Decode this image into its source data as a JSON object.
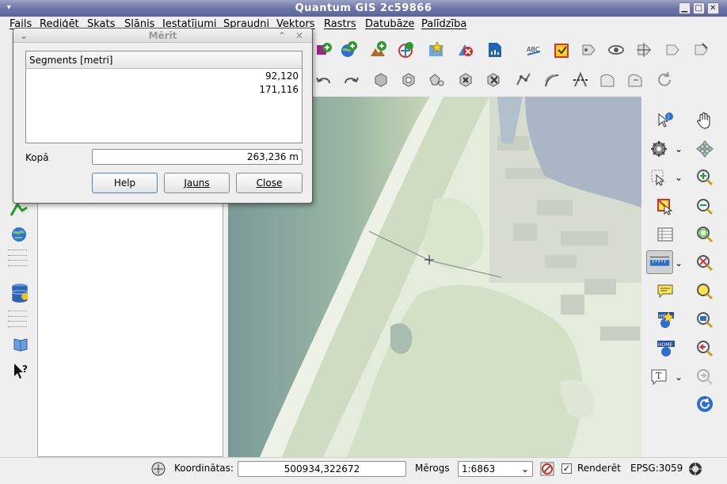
{
  "window": {
    "title": "Quantum GIS 2c59866"
  },
  "menu": [
    "Fails",
    "Rediģēt",
    "Skats",
    "Slānis",
    "Iestatījumi",
    "Spraudņi",
    "Vektors",
    "Rastrs",
    "Datubāze",
    "Palīdzība"
  ],
  "dialog": {
    "title": "Mērīt",
    "column_header": "Segments [metri]",
    "segments": [
      "92,120",
      "171,116"
    ],
    "total_label": "Kopā",
    "total_value": "263,236 m",
    "buttons": {
      "help": "Help",
      "new": "Jauns",
      "close": "Close"
    }
  },
  "status": {
    "coord_label": "Koordinātas:",
    "coord_value": "500934,322672",
    "scale_label": "Mērogs",
    "scale_value": "1:6863",
    "render_label": "Renderēt",
    "render_checked": true,
    "crs": "EPSG:3059"
  },
  "icons": {
    "left": [
      "internet-globe-icon",
      "database-icon",
      "book-icon",
      "whats-this-icon"
    ],
    "right": [
      "identify-icon",
      "pan-icon",
      "settings-icon",
      "pan-to-selected-icon",
      "select-icon",
      "zoom-in-icon",
      "deselect-icon",
      "zoom-out-icon",
      "attribute-table-icon",
      "zoom-full-icon",
      "measure-icon",
      "zoom-to-selection-icon",
      "map-tips-icon",
      "zoom-to-layer-icon",
      "new-bookmark-icon",
      "zoom-actual-icon",
      "show-bookmarks-icon",
      "zoom-last-icon",
      "text-annotation-icon",
      "zoom-next-icon",
      "refresh-icon"
    ]
  },
  "colors": {
    "title_bar": "#6d76a8",
    "map_water": "#9ab6a4",
    "map_land": "#dfe9d5"
  }
}
